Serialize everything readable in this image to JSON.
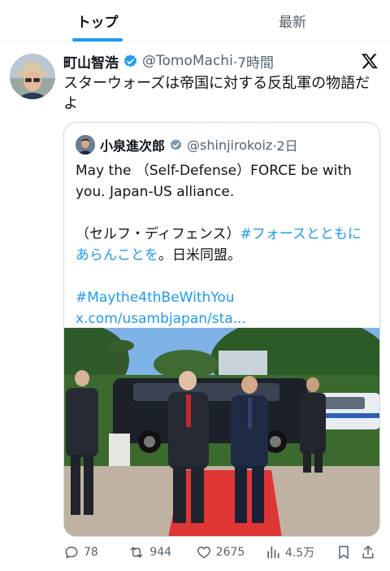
{
  "tabs": [
    {
      "label": "トップ",
      "active": true
    },
    {
      "label": "最新",
      "active": false
    }
  ],
  "tweet": {
    "author_name": "町山智浩",
    "handle": "@TomoMachi",
    "time": "·7時間",
    "text": "スターウォーズは帝国に対する反乱軍の物語だよ"
  },
  "quote": {
    "author_name": "小泉進次郎",
    "handle": "@shinjirokoiz",
    "time": "·2日",
    "line1": "May the （Self-Defense）FORCE be with you. Japan-US alliance.",
    "line2_plain_a": "（セルフ・ディフェンス）",
    "line2_hashtag": "#フォースとともにあらんことを",
    "line2_plain_b": "。日米同盟。",
    "hashtag": "#Maythe4thBeWithYou",
    "link": "x.com/usambjapan/sta..."
  },
  "actions": {
    "replies": "78",
    "reposts": "944",
    "likes": "2675",
    "views": "4.5万"
  },
  "colors": {
    "accent": "#1d9bf0",
    "text": "#0f1419",
    "muted": "#536471",
    "border": "#cfd9de",
    "red_carpet": "#e03535"
  },
  "icons": [
    "verified-badge-icon",
    "x-logo-icon",
    "reply-icon",
    "repost-icon",
    "like-icon",
    "views-icon",
    "bookmark-icon",
    "share-icon"
  ]
}
